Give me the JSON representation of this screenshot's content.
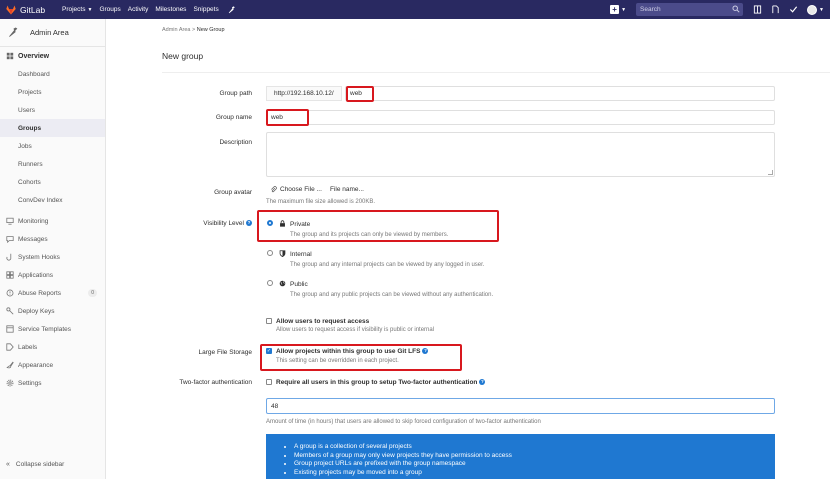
{
  "navbar": {
    "brand": "GitLab",
    "links": [
      {
        "label": "Projects",
        "caret": true
      },
      {
        "label": "Groups",
        "caret": false
      },
      {
        "label": "Activity",
        "caret": false
      },
      {
        "label": "Milestones",
        "caret": false
      },
      {
        "label": "Snippets",
        "caret": false
      }
    ],
    "search_placeholder": "Search",
    "bg_color": "#292961"
  },
  "sidebar": {
    "title": "Admin Area",
    "overview": "Overview",
    "sub_items": [
      "Dashboard",
      "Projects",
      "Users",
      "Groups",
      "Jobs",
      "Runners",
      "Cohorts",
      "ConvDev Index"
    ],
    "active_item": "Groups",
    "items": [
      {
        "label": "Monitoring",
        "icon": "monitor-icon"
      },
      {
        "label": "Messages",
        "icon": "messages-icon"
      },
      {
        "label": "System Hooks",
        "icon": "hook-icon"
      },
      {
        "label": "Applications",
        "icon": "applications-icon"
      },
      {
        "label": "Abuse Reports",
        "icon": "abuse-icon",
        "badge": "0"
      },
      {
        "label": "Deploy Keys",
        "icon": "key-icon"
      },
      {
        "label": "Service Templates",
        "icon": "template-icon"
      },
      {
        "label": "Labels",
        "icon": "label-icon"
      },
      {
        "label": "Appearance",
        "icon": "appearance-icon"
      },
      {
        "label": "Settings",
        "icon": "settings-icon"
      }
    ],
    "collapse": "Collapse sidebar"
  },
  "breadcrumb": {
    "parent": "Admin Area",
    "separator": ">",
    "current": "New Group"
  },
  "page_title": "New group",
  "form": {
    "group_path": {
      "label": "Group path",
      "prefix": "http://192.168.10.12/",
      "value": "web"
    },
    "group_name": {
      "label": "Group name",
      "value": "web"
    },
    "description": {
      "label": "Description",
      "value": ""
    },
    "avatar": {
      "label": "Group avatar",
      "button": "Choose File ...",
      "file_name": "File name...",
      "hint": "The maximum file size allowed is 200KB."
    },
    "visibility": {
      "label": "Visibility Level",
      "selected": "Private",
      "options": [
        {
          "title": "Private",
          "desc": "The group and its projects can only be viewed by members."
        },
        {
          "title": "Internal",
          "desc": "The group and any internal projects can be viewed by any logged in user."
        },
        {
          "title": "Public",
          "desc": "The group and any public projects can be viewed without any authentication."
        }
      ]
    },
    "request_access": {
      "title": "Allow users to request access",
      "desc": "Allow users to request access if visibility is public or internal",
      "checked": false
    },
    "lfs": {
      "label": "Large File Storage",
      "title": "Allow projects within this group to use Git LFS",
      "desc": "This setting can be overridden in each project.",
      "checked": true
    },
    "two_factor": {
      "label": "Two-factor authentication",
      "title": "Require all users in this group to setup Two-factor authentication",
      "checked": false,
      "grace_value": "48",
      "grace_hint": "Amount of time (in hours) that users are allowed to skip forced configuration of two-factor authentication"
    }
  },
  "info_box": [
    "A group is a collection of several projects",
    "Members of a group may only view projects they have permission to access",
    "Group project URLs are prefixed with the group namespace",
    "Existing projects may be moved into a group"
  ],
  "colors": {
    "accent": "#1f78d1",
    "highlight": "#d8181e"
  }
}
